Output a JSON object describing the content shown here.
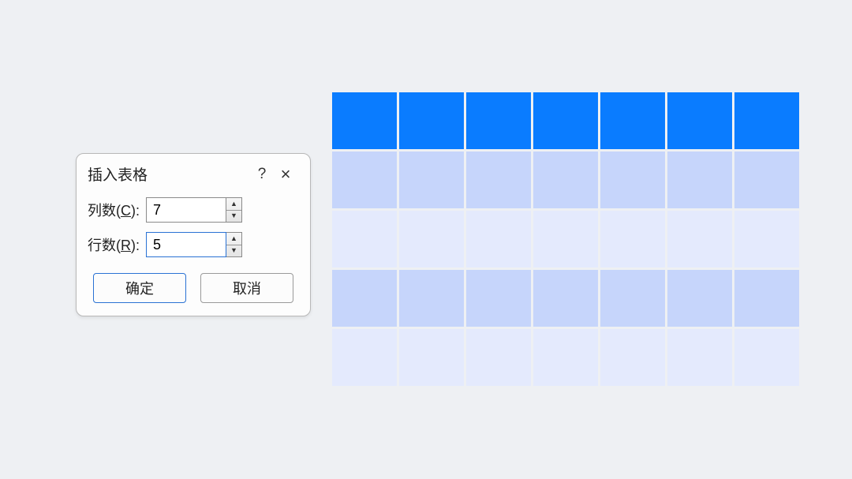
{
  "dialog": {
    "title": "插入表格",
    "help_symbol": "?",
    "close_symbol": "×",
    "columns_label_pre": "列数(",
    "columns_mnemonic": "C",
    "columns_label_post": "):",
    "columns_value": "7",
    "rows_label_pre": "行数(",
    "rows_mnemonic": "R",
    "rows_label_post": "):",
    "rows_value": "5",
    "ok_label": "确定",
    "cancel_label": "取消"
  },
  "table": {
    "rows": 5,
    "cols": 7
  }
}
